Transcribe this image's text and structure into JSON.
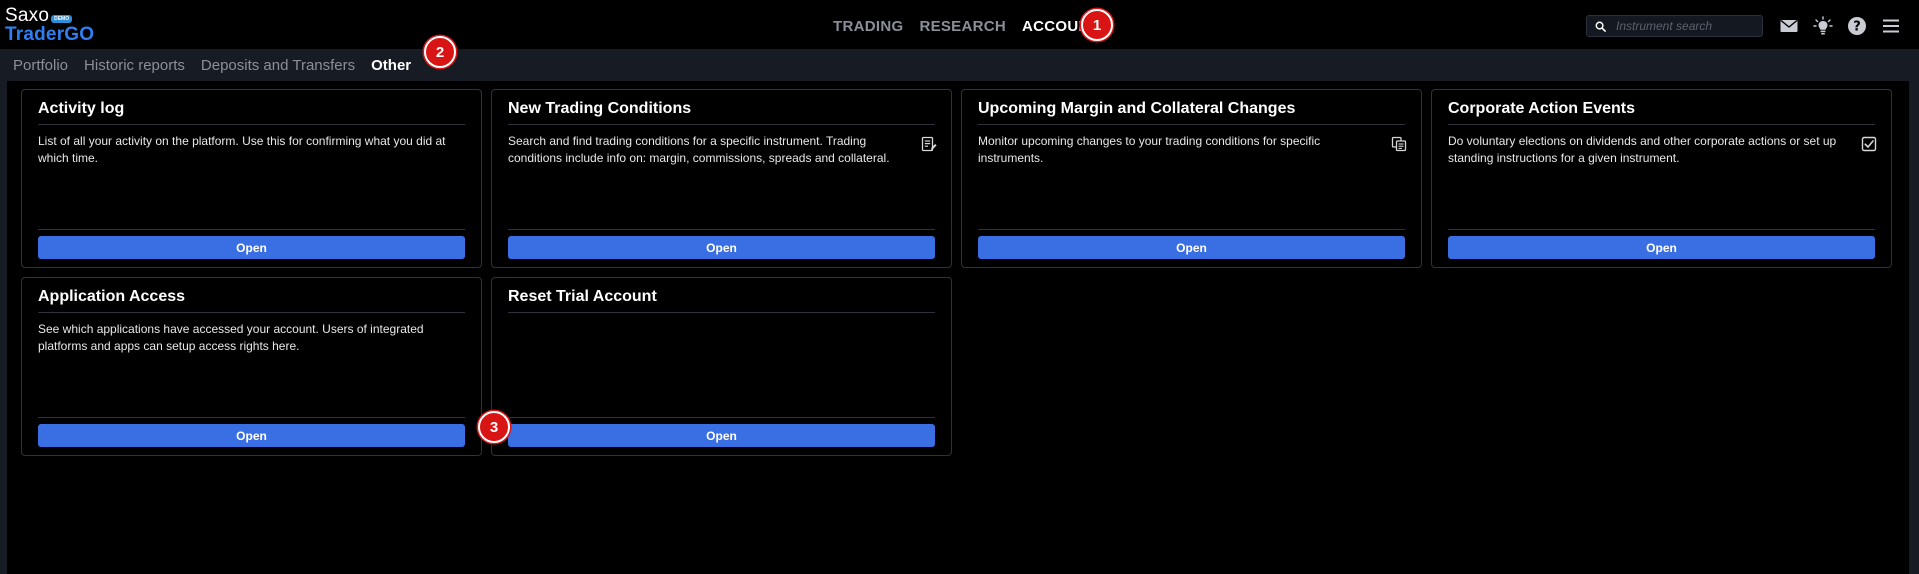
{
  "brand": {
    "name_top": "Saxo",
    "tag": "DEMO",
    "name_bottom": "TraderGO"
  },
  "main_nav": {
    "items": [
      "TRADING",
      "RESEARCH",
      "ACCOUNT"
    ],
    "active": "ACCOUNT"
  },
  "search": {
    "placeholder": "Instrument search"
  },
  "header_icons": [
    "mail-icon",
    "lightbulb-icon",
    "help-icon",
    "menu-icon"
  ],
  "sub_nav": {
    "items": [
      "Portfolio",
      "Historic reports",
      "Deposits and Transfers",
      "Other"
    ],
    "active": "Other"
  },
  "markers": [
    "1",
    "2",
    "3"
  ],
  "cards": [
    {
      "title": "Activity log",
      "description": "List of all your activity on the platform. Use this for confirming what you did at which time.",
      "icon": "",
      "button": "Open"
    },
    {
      "title": "New Trading Conditions",
      "description": "Search and find trading conditions for a specific instrument. Trading conditions include info on: margin, commissions, spreads and collateral.",
      "icon": "document-edit-icon",
      "button": "Open"
    },
    {
      "title": "Upcoming Margin and Collateral Changes",
      "description": "Monitor upcoming changes to your trading conditions for specific instruments.",
      "icon": "copy-icon",
      "button": "Open"
    },
    {
      "title": "Corporate Action Events",
      "description": "Do voluntary elections on dividends and other corporate actions or set up standing instructions for a given instrument.",
      "icon": "checkbox-icon",
      "button": "Open"
    },
    {
      "title": "Application Access",
      "description": "See which applications have accessed your account. Users of integrated platforms and apps can setup access rights here.",
      "icon": "",
      "button": "Open"
    },
    {
      "title": "Reset Trial Account",
      "description": "",
      "icon": "",
      "button": "Open"
    }
  ],
  "colors": {
    "accent_blue": "#3a6fe3",
    "brand_blue": "#2f7ff0",
    "marker_red": "#d91414",
    "frame": "#171b24",
    "card_border": "#2d323c"
  }
}
